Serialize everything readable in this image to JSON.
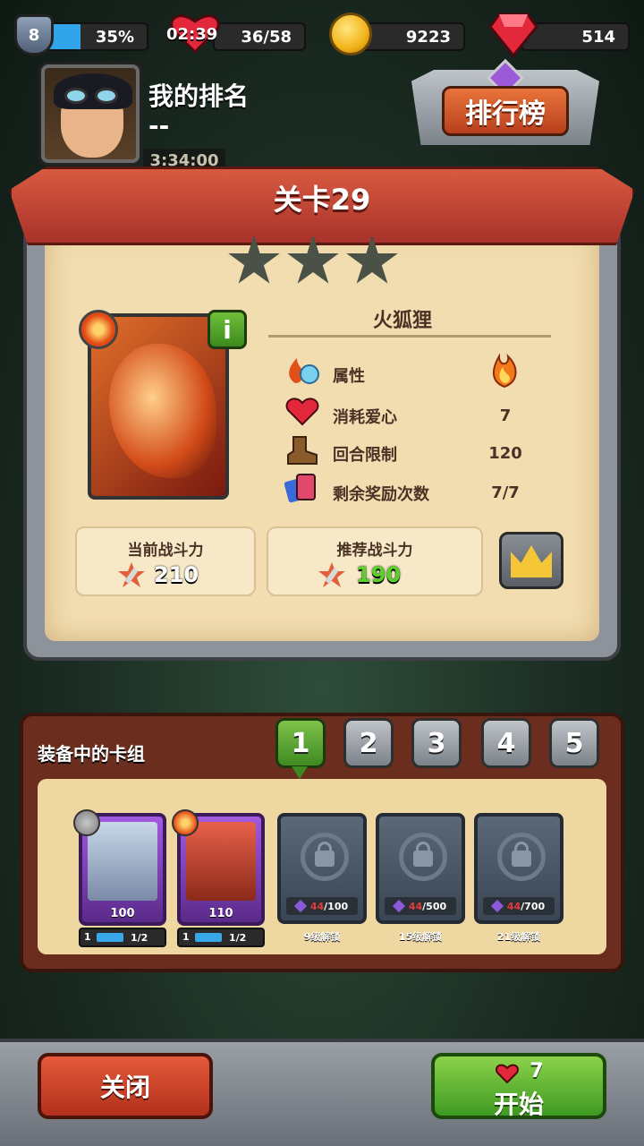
{
  "status_bar": {
    "player_level": "8",
    "xp_percent_text": "35%",
    "xp_fraction": 0.35,
    "heart_timer": "02:39",
    "hearts": "36/58",
    "coins": "9223",
    "gems": "514"
  },
  "player": {
    "rank_title": "我的排名",
    "rank_value": "--",
    "event_timer": "3:34:00",
    "leaderboard_button": "排行榜"
  },
  "level": {
    "title": "关卡29",
    "stars_earned": 0,
    "stars_total": 3,
    "monster_name": "火狐狸",
    "stats": [
      {
        "icon": "fire-ice-icon",
        "label": "属性",
        "value_icon": "fire-icon"
      },
      {
        "icon": "heart-icon",
        "label": "消耗爱心",
        "value": "7"
      },
      {
        "icon": "boot-icon",
        "label": "回合限制",
        "value": "120"
      },
      {
        "icon": "cards-icon",
        "label": "剩余奖励次数",
        "value": "7/7"
      }
    ],
    "current_power_label": "当前战斗力",
    "current_power": "210",
    "recommended_power_label": "推荐战斗力",
    "recommended_power": "190",
    "recommended_power_color": "#5ad02a"
  },
  "deck": {
    "title": "装备中的卡组",
    "slots": [
      "1",
      "2",
      "3",
      "4",
      "5"
    ],
    "active_slot": "1",
    "cards": [
      {
        "element": "neutral",
        "power": "100",
        "level": "1",
        "count": "1/2"
      },
      {
        "element": "fire",
        "power": "110",
        "level": "1",
        "count": "1/2"
      }
    ],
    "locked": [
      {
        "have": "44",
        "need": "/100",
        "unlock": "9级解锁"
      },
      {
        "have": "44",
        "need": "/500",
        "unlock": "15级解锁"
      },
      {
        "have": "44",
        "need": "/700",
        "unlock": "21级解锁"
      }
    ]
  },
  "actions": {
    "close_label": "关闭",
    "start_label": "开始",
    "start_cost": "7"
  },
  "colors": {
    "accent_red": "#b8401e",
    "accent_green": "#3e9a22",
    "paper": "#f2ddb0"
  }
}
